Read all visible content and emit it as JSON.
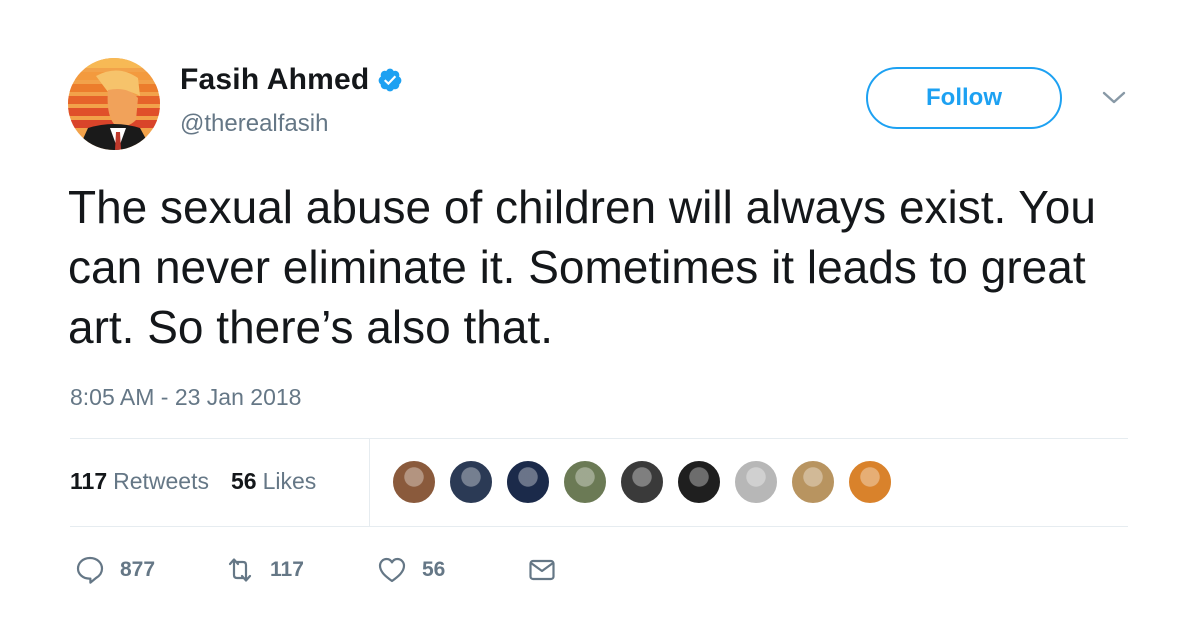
{
  "author": {
    "name": "Fasih Ahmed",
    "handle": "@therealfasih",
    "verified": true
  },
  "follow_label": "Follow",
  "tweet": {
    "text": "The sexual abuse of children will always exist. You can never eliminate it. Sometimes it leads to great art. So there’s also that.",
    "timestamp": "8:05 AM - 23 Jan 2018"
  },
  "stats": {
    "retweets_count": "117",
    "retweets_label": "Retweets",
    "likes_count": "56",
    "likes_label": "Likes"
  },
  "likers": [
    {
      "color": "#8a5a3c"
    },
    {
      "color": "#2b3a55"
    },
    {
      "color": "#1b2a4a"
    },
    {
      "color": "#6b7a55"
    },
    {
      "color": "#3a3a3a"
    },
    {
      "color": "#1f1f1f"
    },
    {
      "color": "#b7b7b7"
    },
    {
      "color": "#b89460"
    },
    {
      "color": "#d9822b"
    }
  ],
  "actions": {
    "reply_count": "877",
    "retweet_count": "117",
    "like_count": "56"
  },
  "colors": {
    "accent": "#1da1f2",
    "secondary_text": "#657786"
  }
}
